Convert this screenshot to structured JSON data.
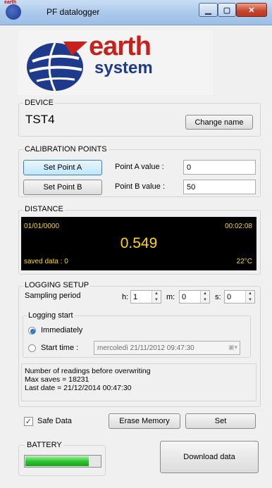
{
  "window": {
    "title": "PF datalogger",
    "icon_text": "earth",
    "min_glyph": "▁",
    "max_glyph": "▢",
    "close_glyph": "✕"
  },
  "logo": {
    "word1": "earth",
    "word2": "system"
  },
  "device": {
    "title": "DEVICE",
    "name": "TST4",
    "change_name_label": "Change name"
  },
  "calibration": {
    "title": "CALIBRATION POINTS",
    "set_a_label": "Set Point A",
    "set_b_label": "Set Point B",
    "a_value_label": "Point A value :",
    "b_value_label": "Point B value :",
    "a_value": "0",
    "b_value": "50"
  },
  "distance": {
    "title": "DISTANCE",
    "date": "01/01/0000",
    "time": "00:02:08",
    "value": "0.549",
    "saved": "saved data  : 0",
    "temperature": "22°C"
  },
  "logging": {
    "title": "LOGGING SETUP",
    "sampling_label": "Sampling period",
    "h_label": "h:",
    "h_value": "1",
    "m_label": "m:",
    "m_value": "0",
    "s_label": "s:",
    "s_value": "0",
    "start_title": "Logging start",
    "immediately_label": "Immediately",
    "start_time_label": "Start time :",
    "start_time_value": "mercoledì 21/11/2012 09:47:30",
    "immediately_selected": true,
    "info_line1": "Number of readings before overwriting",
    "info_line2": "Max saves = 18231",
    "info_line3": "Last date = 21/12/2014 00:47:30"
  },
  "actions": {
    "safe_data_label": "Safe Data",
    "safe_data_checked": true,
    "erase_label": "Erase Memory",
    "set_label": "Set"
  },
  "battery": {
    "title": "BATTERY",
    "level": 0.85
  },
  "download_label": "Download data",
  "colors": {
    "lcd_text": "#ffd800",
    "lcd_bg": "#000000",
    "battery_green": "#29c229",
    "logo_red": "#c8201a",
    "logo_blue": "#1d3a8c"
  }
}
